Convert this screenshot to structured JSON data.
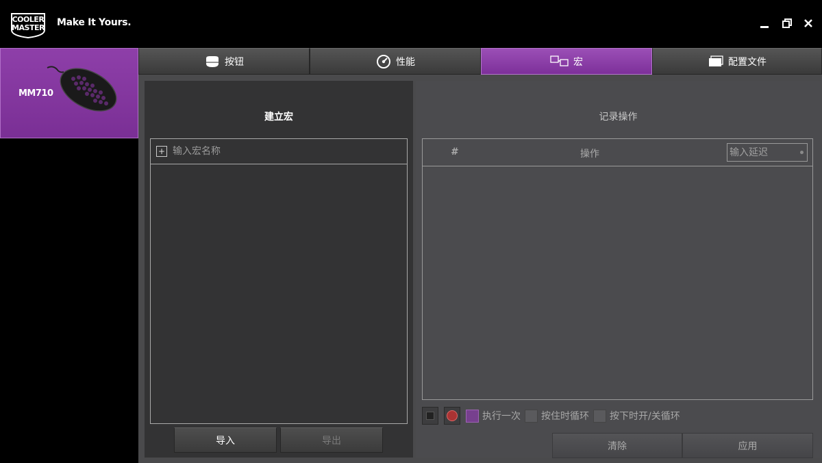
{
  "brand": {
    "logo_line1": "COOLER",
    "logo_line2": "MASTER",
    "tagline": "Make It Yours."
  },
  "window_controls": {
    "minimize": "minimize-icon",
    "restore": "restore-icon",
    "close": "close-icon"
  },
  "device": {
    "name": "MM710"
  },
  "tabs": [
    {
      "label": "按钮",
      "icon": "mouse-icon",
      "active": false
    },
    {
      "label": "性能",
      "icon": "gauge-icon",
      "active": false
    },
    {
      "label": "宏",
      "icon": "macro-icon",
      "active": true
    },
    {
      "label": "配置文件",
      "icon": "profile-icon",
      "active": false
    }
  ],
  "left_panel": {
    "title": "建立宏",
    "macro_name_placeholder": "输入宏名称",
    "import_label": "导入",
    "export_label": "导出"
  },
  "right_panel": {
    "title": "记录操作",
    "col_num": "#",
    "col_operation": "操作",
    "delay_placeholder": "输入延迟",
    "options": [
      {
        "label": "执行一次",
        "checked": true
      },
      {
        "label": "按住时循环",
        "checked": false
      },
      {
        "label": "按下时开/关循环",
        "checked": false
      }
    ],
    "clear_label": "清除",
    "apply_label": "应用"
  },
  "colors": {
    "accent_purple": "#8e3fa9",
    "panel_dark": "#333334",
    "panel_gray": "#4b4b4e"
  }
}
